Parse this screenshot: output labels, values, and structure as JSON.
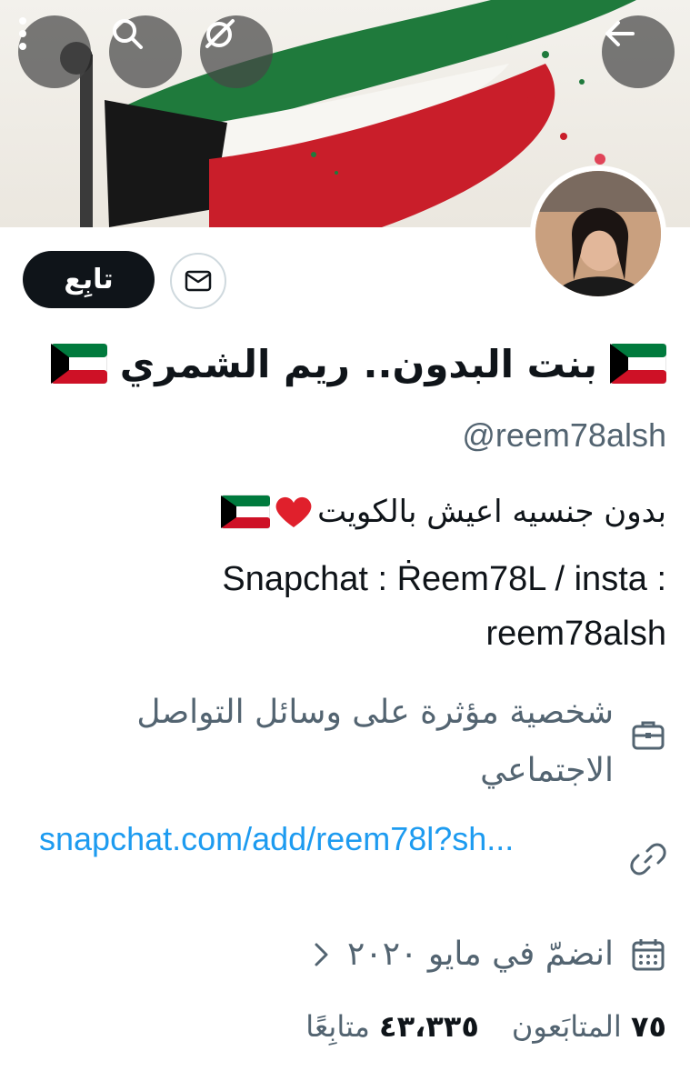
{
  "header": {
    "back_icon": "arrow-left-icon",
    "grok_icon": "grok-icon",
    "search_icon": "search-icon",
    "more_icon": "more-vertical-icon"
  },
  "profile": {
    "follow_label": "تابِع",
    "display_name": "بنت البدون.. ريم الشمري",
    "handle": "@reem78alsh",
    "bio_line1": "بدون جنسيه اعيش بالكويت",
    "bio_line2": "Snapchat : Ṙeem78L / insta : reem78alsh",
    "category": "شخصية مؤثرة على وسائل التواصل الاجتماعي",
    "link": "snapchat.com/add/reem78l?sh...",
    "joined": "انضمّ في مايو ٢٠٢٠",
    "following_count": "٧٥",
    "following_label": "المتابَعون",
    "followers_count": "٤٣،٣٣٥",
    "followers_label": "متابِعًا"
  },
  "colors": {
    "accent": "#1d9bf0",
    "secondary_text": "#536471",
    "primary_text": "#0f1419",
    "kuwait_green": "#007a3d",
    "kuwait_red": "#ce1126"
  }
}
